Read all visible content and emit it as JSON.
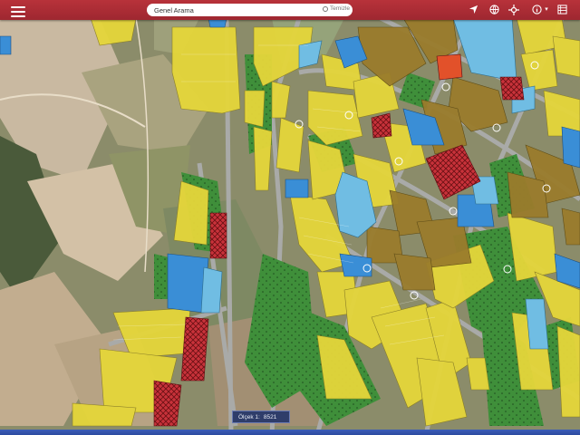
{
  "app": {
    "accent_color": "#b8323a"
  },
  "search": {
    "placeholder": "Genel Arama",
    "clear_label": "Temizle"
  },
  "toolbar": {
    "icons": [
      "location-arrow-icon",
      "globe-icon",
      "crosshair-icon",
      "info-icon",
      "caret-down-icon",
      "layers-list-icon"
    ]
  },
  "status": {
    "label": "Ölçek 1:",
    "value": "8521"
  },
  "map": {
    "zoning_colors": {
      "residential": "#e6d83a",
      "commercial": "#9c7b2b",
      "public_facility": "#3b8fd8",
      "education": "#6bb8e0",
      "health": "#d43535",
      "green_area": "#3c8a3c",
      "road": "#9a9a9a",
      "agriculture": "#b49d7f"
    }
  }
}
